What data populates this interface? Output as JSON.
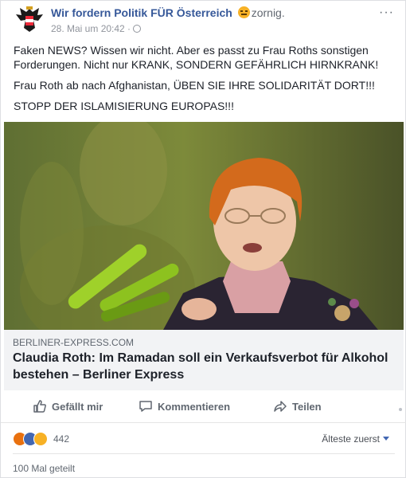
{
  "post": {
    "page_name": "Wir fordern Politik FÜR Österreich",
    "feeling": "zornig.",
    "feeling_icon": "angry-face-icon",
    "timestamp": "28. Mai um 20:42 ·",
    "more_icon": "ellipsis-icon",
    "paragraphs": [
      "Faken NEWS? Wissen wir nicht. Aber es passt zu Frau Roths sonstigen Forderungen. Nicht nur KRANK, SONDERN GEFÄHRLICH HIRNKRANK!",
      "Frau Roth ab nach Afghanistan, ÜBEN SIE IHRE SOLIDARITÄT DORT!!!",
      "STOPP DER ISLAMISIERUNG EUROPAS!!!"
    ]
  },
  "link_preview": {
    "domain": "BERLINER-EXPRESS.COM",
    "headline": "Claudia Roth: Im Ramadan soll ein Verkaufsverbot für Alkohol bestehen – Berliner Express"
  },
  "actions": {
    "like_label": "Gefällt mir",
    "comment_label": "Kommentieren",
    "share_label": "Teilen"
  },
  "reactions": {
    "types": [
      "angry",
      "like",
      "haha"
    ],
    "count": "442"
  },
  "comments": {
    "sort_label": "Älteste zuerst"
  },
  "shares": {
    "label": "100 Mal geteilt"
  },
  "colors": {
    "link_blue": "#365899",
    "accent_blue": "#4267b2",
    "preview_bg": "#f2f3f5"
  }
}
